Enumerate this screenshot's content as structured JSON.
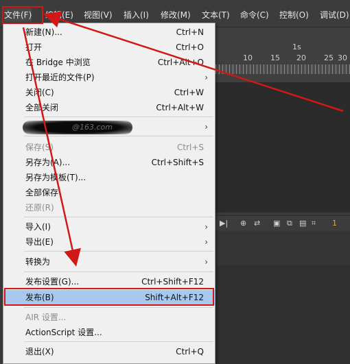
{
  "menubar": {
    "items": [
      "文件(F)",
      "编辑(E)",
      "视图(V)",
      "插入(I)",
      "修改(M)",
      "文本(T)",
      "命令(C)",
      "控制(O)",
      "调试(D)"
    ]
  },
  "timeline": {
    "ruler_second_label": "1s",
    "ruler_ticks": [
      "10",
      "15",
      "20",
      "25",
      "30"
    ],
    "toolbar_frame": "1"
  },
  "file_menu": {
    "items": [
      {
        "label": "新建(N)...",
        "shortcut": "Ctrl+N"
      },
      {
        "label": "打开",
        "shortcut": "Ctrl+O"
      },
      {
        "label": "在 Bridge 中浏览",
        "shortcut": "Ctrl+Alt+O"
      },
      {
        "label": "打开最近的文件(P)",
        "submenu": true
      },
      {
        "label": "关闭(C)",
        "shortcut": "Ctrl+W"
      },
      {
        "label": "全部关闭",
        "shortcut": "Ctrl+Alt+W"
      },
      {
        "label": "@163.com",
        "submenu": true
      },
      {
        "label": "保存(S)",
        "shortcut": "Ctrl+S",
        "disabled": true
      },
      {
        "label": "另存为(A)...",
        "shortcut": "Ctrl+Shift+S"
      },
      {
        "label": "另存为模板(T)..."
      },
      {
        "label": "全部保存"
      },
      {
        "label": "还原(R)",
        "disabled": true
      },
      {
        "label": "导入(I)",
        "submenu": true
      },
      {
        "label": "导出(E)",
        "submenu": true
      },
      {
        "label": "转换为",
        "submenu": true
      },
      {
        "label": "发布设置(G)...",
        "shortcut": "Ctrl+Shift+F12"
      },
      {
        "label": "发布(B)",
        "shortcut": "Shift+Alt+F12",
        "highlighted": true
      },
      {
        "label": "AIR 设置...",
        "disabled": true
      },
      {
        "label": "ActionScript 设置..."
      },
      {
        "label": "退出(X)",
        "shortcut": "Ctrl+Q"
      }
    ],
    "submenu_arrow": "›"
  },
  "colors": {
    "annotation_red": "#d01818",
    "highlight_blue": "#a8c8ee",
    "menubar_bg": "#3c3c3c",
    "menu_bg": "#f0f0f0"
  }
}
